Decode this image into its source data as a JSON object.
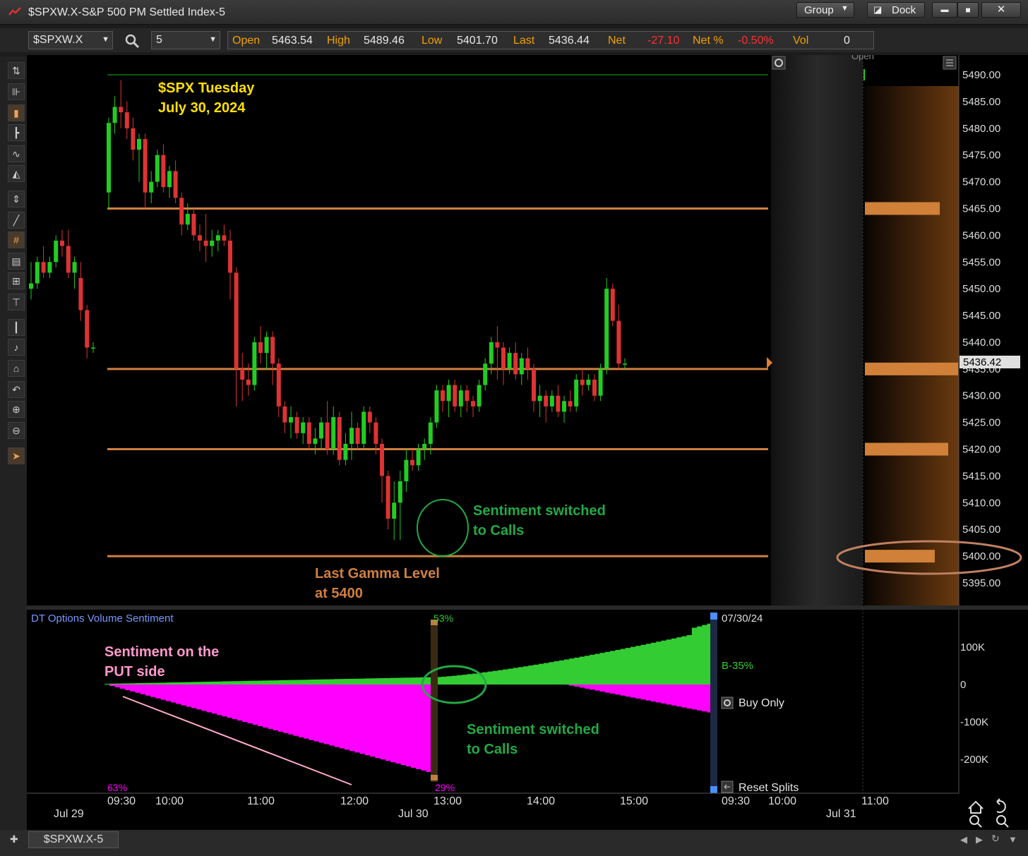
{
  "window": {
    "title": "$SPXW.X-S&P 500 PM Settled Index-5",
    "group_label": "Group",
    "dock_label": "Dock",
    "min_label": "▬",
    "max_label": "■",
    "close_label": "✕"
  },
  "symbol_bar": {
    "symbol": "$SPXW.X",
    "interval": "5",
    "quote": {
      "open_label": "Open",
      "open_value": "5463.54",
      "high_label": "High",
      "high_value": "5489.46",
      "low_label": "Low",
      "low_value": "5401.70",
      "last_label": "Last",
      "last_value": "5436.44",
      "net_label": "Net",
      "net_value": "-27.10",
      "netpct_label": "Net %",
      "netpct_value": "-0.50%",
      "vol_label": "Vol",
      "vol_value": "0"
    }
  },
  "price_chart": {
    "title_line1": "$SPX Tuesday",
    "title_line2": "July 30, 2024",
    "y_ticks": [
      "5490.00",
      "5485.00",
      "5480.00",
      "5475.00",
      "5470.00",
      "5465.00",
      "5460.00",
      "5455.00",
      "5450.00",
      "5445.00",
      "5440.00",
      "5435.00",
      "5430.00",
      "5425.00",
      "5420.00",
      "5415.00",
      "5410.00",
      "5405.00",
      "5400.00",
      "5395.00"
    ],
    "last_price_label": "5436.42",
    "open_marker": "Open",
    "gamma_levels": [
      5465,
      5435,
      5420,
      5400
    ],
    "annotation_sentiment_line1": "Sentiment switched",
    "annotation_sentiment_line2": "to Calls",
    "annotation_gamma_line1": "Last Gamma Level",
    "annotation_gamma_line2": "at 5400",
    "colors": {
      "up": "#22cc22",
      "down": "#dd3333",
      "gamma": "#d08040",
      "annot_title": "#ffe000",
      "annot_green": "#22aa44",
      "annot_orange": "#d08040"
    }
  },
  "sentiment_panel": {
    "title": "DT Options Volume Sentiment",
    "pct_top": "53%",
    "pct_left": "63%",
    "pct_mid": "29%",
    "date_label": "07/30/24",
    "b_label": "B-35%",
    "buy_only_label": "Buy Only",
    "reset_splits_label": "Reset Splits",
    "y_ticks": [
      "100K",
      "0",
      "-100K",
      "-200K"
    ],
    "annotation_put_line1": "Sentiment on the",
    "annotation_put_line2": "PUT side",
    "annotation_calls_line1": "Sentiment switched",
    "annotation_calls_line2": "to Calls",
    "colors": {
      "calls": "#33cc33",
      "puts": "#ff00ff",
      "put_label": "#ff99cc",
      "calls_label": "#22aa44"
    }
  },
  "x_axis": {
    "times": [
      "09:30",
      "10:00",
      "11:00",
      "12:00",
      "13:00",
      "14:00",
      "15:00",
      "09:30",
      "10:00",
      "11:00"
    ],
    "dates": [
      "Jul 29",
      "Jul 30",
      "Jul 31"
    ]
  },
  "bottom_bar": {
    "tab_label": "$SPXW.X-5",
    "add_label": "✚"
  },
  "chart_data": {
    "type": "candlestick",
    "symbol": "$SPXW.X",
    "interval_minutes": 5,
    "ohlc": [
      [
        5450,
        5455,
        5448,
        5451
      ],
      [
        5451,
        5456,
        5450,
        5455
      ],
      [
        5455,
        5458,
        5452,
        5453
      ],
      [
        5453,
        5456,
        5452,
        5455
      ],
      [
        5455,
        5460,
        5454,
        5459
      ],
      [
        5459,
        5461,
        5456,
        5458
      ],
      [
        5458,
        5461,
        5452,
        5453
      ],
      [
        5453,
        5456,
        5450,
        5455
      ],
      [
        5452,
        5455,
        5444,
        5446
      ],
      [
        5446,
        5447,
        5437,
        5439
      ],
      [
        5439,
        5440,
        5438,
        5439
      ],
      [
        5468,
        5482,
        5465,
        5481
      ],
      [
        5481,
        5486,
        5479,
        5484
      ],
      [
        5484,
        5489,
        5480,
        5483
      ],
      [
        5483,
        5485,
        5478,
        5480
      ],
      [
        5480,
        5482,
        5474,
        5476
      ],
      [
        5476,
        5479,
        5470,
        5478
      ],
      [
        5478,
        5479,
        5465,
        5468
      ],
      [
        5468,
        5472,
        5466,
        5470
      ],
      [
        5470,
        5476,
        5469,
        5475
      ],
      [
        5475,
        5477,
        5468,
        5469
      ],
      [
        5469,
        5473,
        5467,
        5472
      ],
      [
        5472,
        5474,
        5466,
        5467
      ],
      [
        5467,
        5468,
        5460,
        5462
      ],
      [
        5462,
        5466,
        5461,
        5464
      ],
      [
        5464,
        5465,
        5459,
        5460
      ],
      [
        5460,
        5462,
        5457,
        5459
      ],
      [
        5459,
        5464,
        5455,
        5458
      ],
      [
        5458,
        5461,
        5456,
        5459
      ],
      [
        5459,
        5461,
        5457,
        5460
      ],
      [
        5460,
        5462,
        5458,
        5459
      ],
      [
        5459,
        5461,
        5448,
        5453
      ],
      [
        5453,
        5454,
        5428,
        5435
      ],
      [
        5435,
        5438,
        5429,
        5433
      ],
      [
        5433,
        5436,
        5430,
        5432
      ],
      [
        5432,
        5441,
        5431,
        5440
      ],
      [
        5440,
        5443,
        5436,
        5438
      ],
      [
        5438,
        5442,
        5435,
        5441
      ],
      [
        5441,
        5442,
        5432,
        5436
      ],
      [
        5436,
        5437,
        5426,
        5428
      ],
      [
        5428,
        5429,
        5423,
        5425
      ],
      [
        5425,
        5428,
        5422,
        5426
      ],
      [
        5426,
        5427,
        5422,
        5423
      ],
      [
        5423,
        5426,
        5421,
        5425
      ],
      [
        5425,
        5426,
        5420,
        5421
      ],
      [
        5421,
        5424,
        5419,
        5422
      ],
      [
        5422,
        5426,
        5420,
        5425
      ],
      [
        5425,
        5429,
        5419,
        5420
      ],
      [
        5420,
        5428,
        5419,
        5426
      ],
      [
        5426,
        5427,
        5417,
        5418
      ],
      [
        5418,
        5423,
        5417,
        5421
      ],
      [
        5421,
        5427,
        5418,
        5424
      ],
      [
        5424,
        5425,
        5420,
        5421
      ],
      [
        5421,
        5428,
        5420,
        5427
      ],
      [
        5427,
        5428,
        5423,
        5425
      ],
      [
        5425,
        5426,
        5419,
        5421
      ],
      [
        5421,
        5422,
        5410,
        5415
      ],
      [
        5415,
        5416,
        5405,
        5407
      ],
      [
        5407,
        5414,
        5403,
        5410
      ],
      [
        5410,
        5416,
        5403,
        5414
      ],
      [
        5414,
        5420,
        5412,
        5418
      ],
      [
        5418,
        5420,
        5416,
        5417
      ],
      [
        5417,
        5421,
        5416,
        5420
      ],
      [
        5420,
        5422,
        5418,
        5421
      ],
      [
        5421,
        5426,
        5419,
        5425
      ],
      [
        5425,
        5432,
        5424,
        5431
      ],
      [
        5431,
        5432,
        5427,
        5429
      ],
      [
        5429,
        5433,
        5426,
        5432
      ],
      [
        5432,
        5433,
        5427,
        5428
      ],
      [
        5428,
        5432,
        5426,
        5431
      ],
      [
        5431,
        5432,
        5427,
        5429
      ],
      [
        5429,
        5430,
        5426,
        5428
      ],
      [
        5428,
        5433,
        5427,
        5432
      ],
      [
        5432,
        5437,
        5431,
        5436
      ],
      [
        5436,
        5441,
        5434,
        5440
      ],
      [
        5440,
        5443,
        5433,
        5439
      ],
      [
        5439,
        5440,
        5432,
        5435
      ],
      [
        5435,
        5439,
        5434,
        5438
      ],
      [
        5438,
        5440,
        5433,
        5434
      ],
      [
        5434,
        5438,
        5432,
        5437
      ],
      [
        5437,
        5439,
        5433,
        5435
      ],
      [
        5435,
        5436,
        5427,
        5429
      ],
      [
        5429,
        5432,
        5426,
        5430
      ],
      [
        5430,
        5431,
        5425,
        5428
      ],
      [
        5428,
        5431,
        5427,
        5430
      ],
      [
        5430,
        5432,
        5426,
        5427
      ],
      [
        5427,
        5430,
        5425,
        5429
      ],
      [
        5429,
        5431,
        5427,
        5428
      ],
      [
        5428,
        5434,
        5427,
        5433
      ],
      [
        5433,
        5435,
        5430,
        5432
      ],
      [
        5432,
        5434,
        5431,
        5433
      ],
      [
        5433,
        5434,
        5429,
        5430
      ],
      [
        5430,
        5436,
        5429,
        5435
      ],
      [
        5435,
        5452,
        5434,
        5450
      ],
      [
        5450,
        5451,
        5443,
        5444
      ],
      [
        5444,
        5447,
        5435,
        5436
      ],
      [
        5436,
        5437,
        5435,
        5436
      ]
    ],
    "gamma_levels": [
      5465,
      5435,
      5420,
      5400
    ],
    "sentiment": {
      "type": "area",
      "calls_end": 170000,
      "puts_min": -250000,
      "puts_end": -80000,
      "call_pct_start": "63%",
      "switch_pct": "29%",
      "top_pct": "53%"
    },
    "ylim": [
      5392,
      5492
    ]
  }
}
